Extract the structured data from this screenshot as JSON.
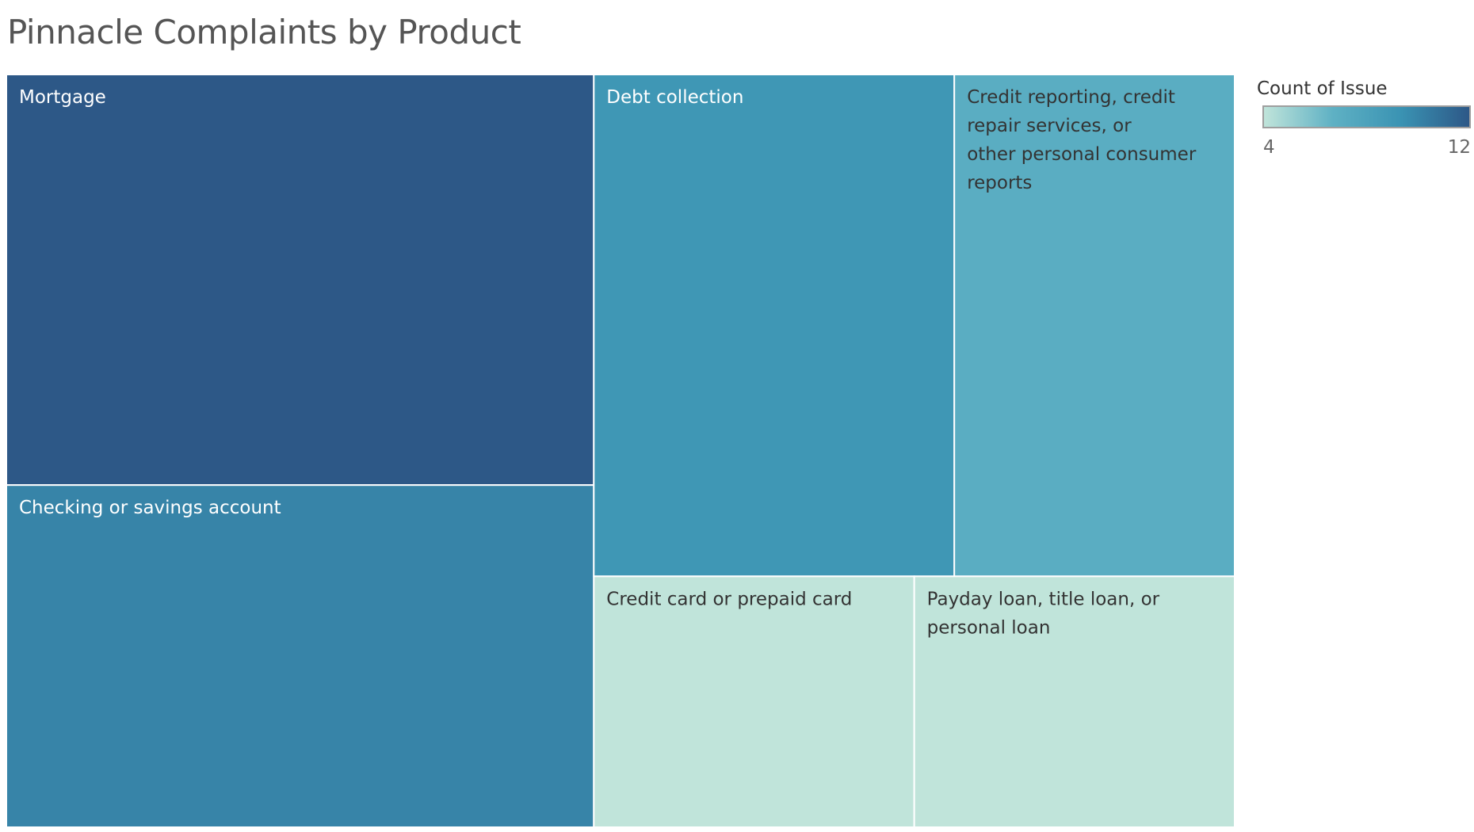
{
  "chart_data": {
    "type": "treemap",
    "title": "Pinnacle Complaints by Product",
    "measure": "Count of Issue",
    "items": [
      {
        "label": "Mortgage",
        "value": 12
      },
      {
        "label": "Checking or savings account",
        "value": 10
      },
      {
        "label": "Debt collection",
        "value": 9
      },
      {
        "label": "Credit reporting, credit repair services, or other personal consumer reports",
        "value": 7
      },
      {
        "label": "Credit card or prepaid card",
        "value": 4
      },
      {
        "label": "Payday loan, title loan, or personal loan",
        "value": 4
      }
    ],
    "color_scale": {
      "min": 4,
      "max": 12,
      "min_label": "4",
      "max_label": "12",
      "stops": [
        "#c0e4da",
        "#5fb1c4",
        "#3a93b3",
        "#2d5887"
      ]
    }
  }
}
